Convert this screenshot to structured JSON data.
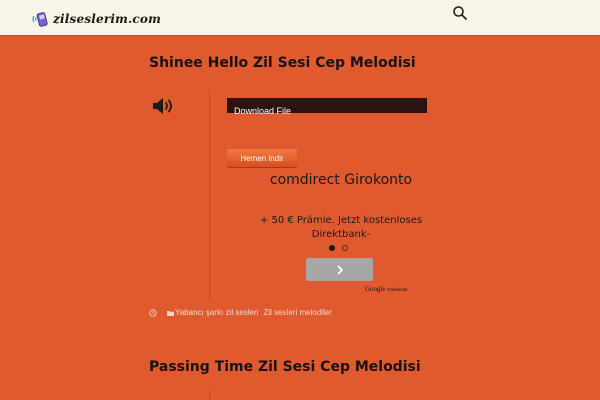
{
  "site": {
    "name": "zilseslerim.com"
  },
  "posts": [
    {
      "title": "Shinee Hello Zil Sesi Cep Melodisi",
      "download_label": "Download File",
      "button_label": "Hemen indir",
      "categories": [
        "Yabancı şarkı zil sesleri",
        "Zil sesleri melodiler"
      ]
    },
    {
      "title": "Passing Time Zil Sesi Cep Melodisi"
    }
  ],
  "ad": {
    "title": "comdirect Girokonto",
    "text": "+ 50 € Prämie. Jetzt kostenloses Direktbank-",
    "footer_brand": "Google",
    "footer_label": "Reklamlar",
    "active_dot": 1,
    "dot_count": 2
  },
  "colors": {
    "background": "#e05a30",
    "topbar": "#f8f4e8",
    "download_bar": "#2b1410",
    "button": "#e8663a",
    "ad_button": "#a6a6a6"
  },
  "icons": [
    "logo-phone-icon",
    "search-icon",
    "speaker-icon",
    "clock-icon",
    "folder-icon",
    "chevron-right-icon"
  ]
}
